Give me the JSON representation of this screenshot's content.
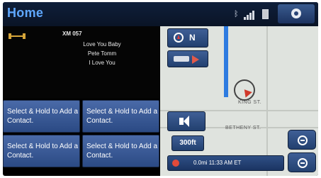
{
  "header": {
    "title": "Home"
  },
  "audio": {
    "channel": "XM 057",
    "lines": [
      "Love You Baby",
      "Pete Tomm",
      "I Love You"
    ]
  },
  "contacts": [
    "Select & Hold to Add a Contact.",
    "Select & Hold to Add a Contact.",
    "Select & Hold to Add a Contact.",
    "Select & Hold to Add a Contact."
  ],
  "map": {
    "compass": "N",
    "scale": "300ft",
    "streets": [
      "KING ST.",
      "BETHENY ST."
    ],
    "eta": "0.0mi   11:33 AM ET"
  },
  "colors": {
    "accent": "#5fa8ff",
    "button": "#3b5b97",
    "route": "#2d7be0",
    "vehicle": "#d0392b"
  }
}
